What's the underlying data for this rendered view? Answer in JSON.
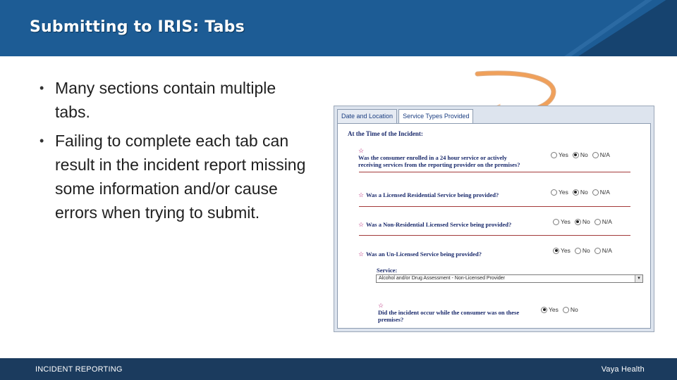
{
  "header": {
    "title": "Submitting to IRIS: Tabs",
    "band_color": "#1d5c95",
    "accent_color": "#16436f"
  },
  "bullets": [
    "Many sections contain multiple tabs.",
    "Failing to complete each tab can result in the incident report missing some information and/or cause errors when trying to submit."
  ],
  "screenshot": {
    "tabs": [
      {
        "label": "Date and Location",
        "active": false
      },
      {
        "label": "Service Types Provided",
        "active": true
      }
    ],
    "section_heading": "At the Time of the Incident:",
    "required_marker": "☆",
    "questions": [
      {
        "text_line1": "Was the consumer enrolled in a 24 hour service or actively",
        "text_line2": "receiving services from the reporting provider on the premises?",
        "options": [
          "Yes",
          "No",
          "N/A"
        ],
        "selected": "No"
      },
      {
        "text_line1": "Was a Licensed Residential Service being provided?",
        "options": [
          "Yes",
          "No",
          "N/A"
        ],
        "selected": "No"
      },
      {
        "text_line1": "Was a Non-Residential Licensed Service being provided?",
        "options": [
          "Yes",
          "No",
          "N/A"
        ],
        "selected": "No"
      },
      {
        "text_line1": "Was an Un-Licensed Service being provided?",
        "options": [
          "Yes",
          "No",
          "N/A"
        ],
        "selected": "Yes"
      },
      {
        "text_line1": "Did the incident occur while the consumer was on these",
        "text_line2": "premises?",
        "options": [
          "Yes",
          "No"
        ],
        "selected": "Yes"
      }
    ],
    "service": {
      "label": "Service:",
      "value": "Alcohol and/or Drug Assessment - Non-Licensed Provider"
    }
  },
  "arrow": {
    "color": "#f0a05a",
    "icon": "curved-arrow-icon"
  },
  "footer": {
    "left": "INCIDENT REPORTING",
    "right": "Vaya Health",
    "color": "#1b3b5e"
  }
}
